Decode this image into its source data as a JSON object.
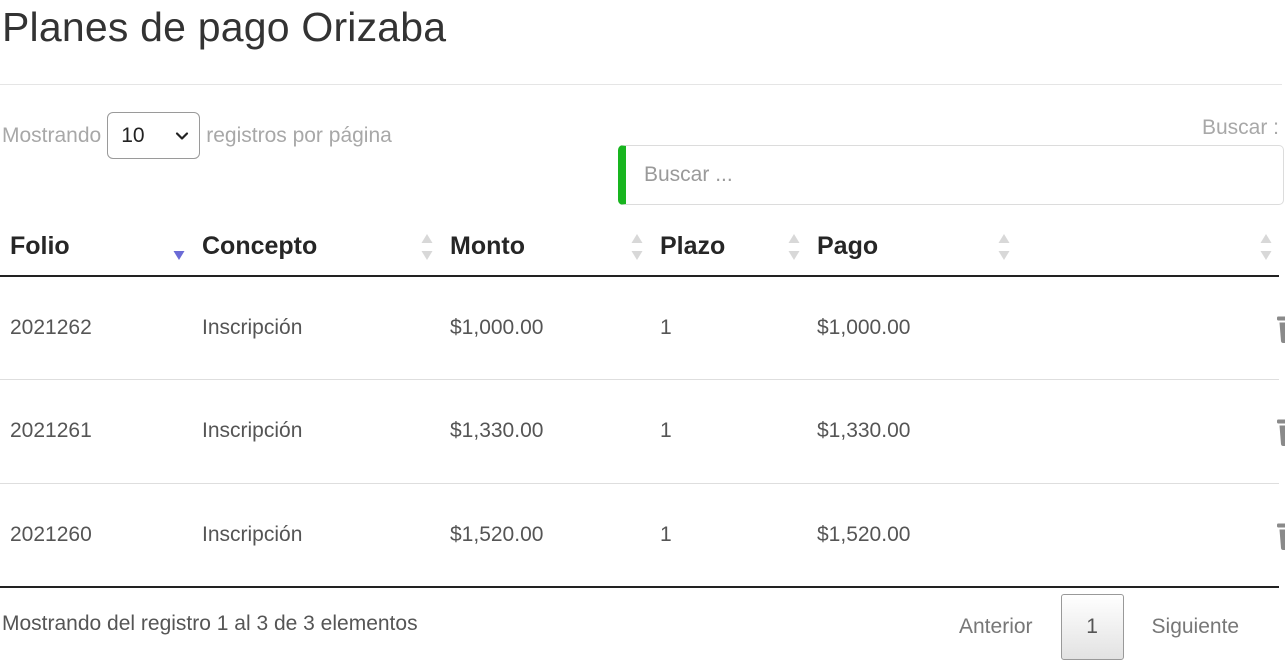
{
  "page": {
    "title": "Planes de pago Orizaba"
  },
  "length_control": {
    "prefix": "Mostrando",
    "selected": "10",
    "suffix": "registros por página"
  },
  "search": {
    "label": "Buscar :",
    "placeholder": "Buscar ...",
    "value": ""
  },
  "table": {
    "columns": [
      "Folio",
      "Concepto",
      "Monto",
      "Plazo",
      "Pago",
      ""
    ],
    "sorted_column": "Folio",
    "sort_direction": "descending",
    "rows": [
      {
        "folio": "2021262",
        "concepto": "Inscripción",
        "monto": "$1,000.00",
        "plazo": "1",
        "pago": "$1,000.00",
        "action_icon": "trash-icon"
      },
      {
        "folio": "2021261",
        "concepto": "Inscripción",
        "monto": "$1,330.00",
        "plazo": "1",
        "pago": "$1,330.00",
        "action_icon": "trash-icon"
      },
      {
        "folio": "2021260",
        "concepto": "Inscripción",
        "monto": "$1,520.00",
        "plazo": "1",
        "pago": "$1,520.00",
        "action_icon": "trash-icon"
      }
    ]
  },
  "footer": {
    "info": "Mostrando del registro 1 al 3 de 3 elementos",
    "pagination": {
      "previous": "Anterior",
      "current": "1",
      "next": "Siguiente"
    }
  },
  "colors": {
    "search_accent": "#18b51f",
    "sort_active": "#6b6bd6",
    "sort_inactive": "#d8d8d8",
    "icon_gray": "#8a8a8a"
  }
}
